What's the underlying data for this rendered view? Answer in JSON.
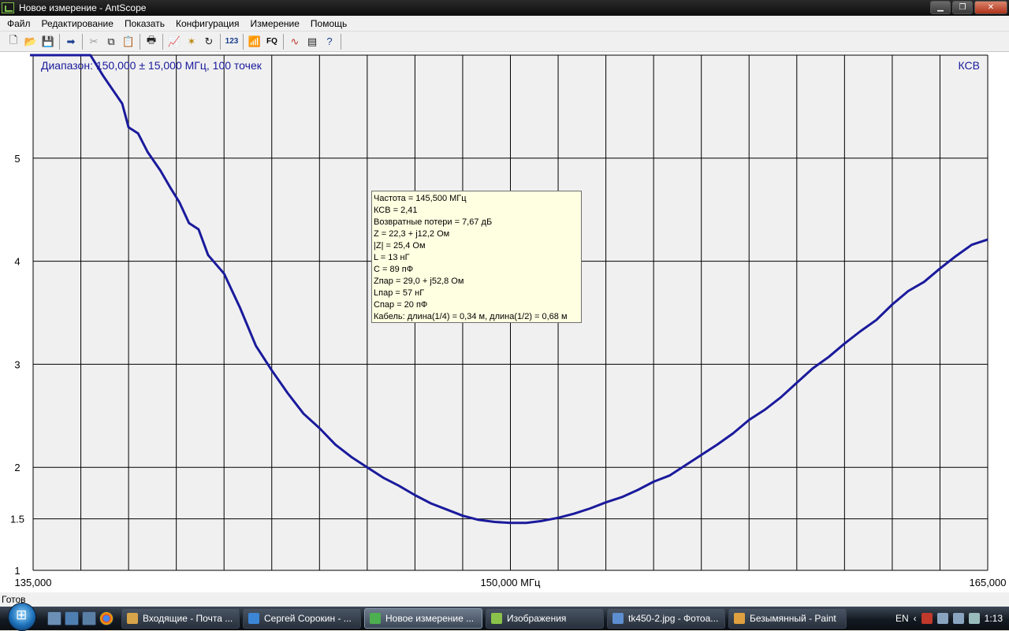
{
  "window": {
    "title": "Новое измерение - AntScope",
    "controls": {
      "minimize": "▁",
      "maximize": "❐",
      "close": "✕"
    }
  },
  "menu": [
    "Файл",
    "Редактирование",
    "Показать",
    "Конфигурация",
    "Измерение",
    "Помощь"
  ],
  "toolbar": {
    "icons": [
      "new-icon",
      "open-icon",
      "save-icon",
      "export-icon",
      "cut-icon",
      "copy-icon",
      "paste-icon",
      "print-icon",
      "graph-icon",
      "marker-icon",
      "refresh-icon",
      "123",
      "antenna-icon",
      "FQ",
      "curve-icon",
      "table-icon",
      "help-icon"
    ],
    "text_123": "123",
    "text_fq": "FQ"
  },
  "chart_data": {
    "type": "line",
    "title": "Диапазон: 150,000 ± 15,000 МГц, 100 точек",
    "right_label": "КСВ",
    "x_tick_labels": [
      "135,000",
      "150,000 МГц",
      "165,000"
    ],
    "xlim": [
      135,
      165
    ],
    "ylim": [
      1,
      6
    ],
    "y_ticks": [
      1,
      1.5,
      2,
      3,
      4,
      5
    ],
    "y_tick_labels": [
      "1",
      "1.5",
      "2",
      "3",
      "4",
      "5"
    ],
    "grid": true,
    "line_color": "#1a1a9c",
    "series": [
      {
        "x": [
          136.8,
          137.2,
          137.8,
          138.0,
          138.3,
          138.6,
          139.0,
          139.3,
          139.6,
          139.9,
          140.2,
          140.5,
          141.0,
          141.5,
          142.0,
          142.5,
          143.0,
          143.5,
          144.0,
          144.5,
          145.0,
          145.5,
          146.0,
          146.5,
          147.0,
          147.5,
          148.0,
          148.5,
          149.0,
          149.5,
          150.0,
          150.5,
          151.0,
          151.5,
          152.0,
          152.5,
          153.0,
          153.5,
          154.0,
          154.5,
          155.0,
          155.5,
          156.0,
          156.5,
          157.0,
          157.5,
          158.0,
          158.5,
          159.0,
          159.5,
          160.0,
          160.5,
          161.0,
          161.5,
          162.0,
          162.5,
          163.0,
          163.5,
          164.0,
          164.5,
          165.0
        ],
        "y": [
          6.3,
          5.8,
          5.53,
          5.3,
          5.24,
          5.06,
          4.88,
          4.72,
          4.57,
          4.37,
          4.31,
          4.06,
          3.88,
          3.55,
          3.18,
          2.94,
          2.72,
          2.52,
          2.38,
          2.22,
          2.1,
          2.0,
          1.9,
          1.82,
          1.73,
          1.65,
          1.59,
          1.53,
          1.49,
          1.47,
          1.46,
          1.46,
          1.48,
          1.51,
          1.55,
          1.6,
          1.66,
          1.71,
          1.78,
          1.86,
          1.92,
          2.02,
          2.12,
          2.22,
          2.33,
          2.46,
          2.56,
          2.68,
          2.82,
          2.96,
          3.07,
          3.2,
          3.32,
          3.43,
          3.58,
          3.71,
          3.8,
          3.93,
          4.05,
          4.16,
          4.21
        ]
      }
    ]
  },
  "tooltip": {
    "lines": [
      "Частота = 145,500 МГц",
      "КСВ = 2,41",
      "Возвратные потери = 7,67 дБ",
      "Z = 22,3 + j12,2 Ом",
      "|Z| = 25,4 Ом",
      "L = 13 нГ",
      "C = 89 пФ",
      "Zпар = 29,0 + j52,8 Ом",
      "Lпар = 57 нГ",
      "Cпар = 20 пФ",
      "Кабель: длина(1/4) = 0,34 м, длина(1/2) = 0,68 м"
    ]
  },
  "status": "Готов",
  "taskbar": {
    "tasks": [
      {
        "label": "Входящие - Почта ...",
        "color": "#d8a44a",
        "active": false
      },
      {
        "label": "Сергей Сорокин - ...",
        "color": "#3b86d6",
        "active": false
      },
      {
        "label": "Новое измерение ...",
        "color": "#4caf50",
        "active": true
      },
      {
        "label": "Изображения",
        "color": "#8bc34a",
        "active": false
      },
      {
        "label": "tk450-2.jpg - Фотоа...",
        "color": "#5d8fd0",
        "active": false
      },
      {
        "label": "Безымянный - Paint",
        "color": "#e0a040",
        "active": false
      }
    ],
    "lang": "EN",
    "clock": "1:13"
  }
}
